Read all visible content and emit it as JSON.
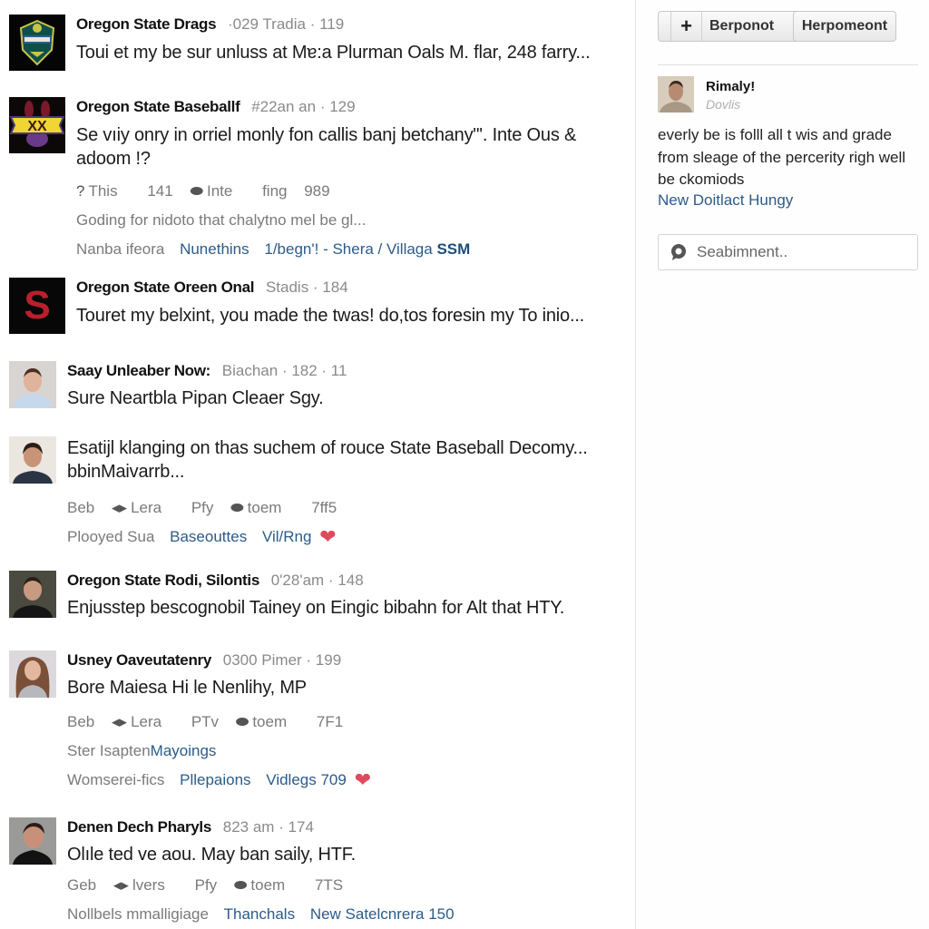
{
  "colors": {
    "link": "#2b5b8a",
    "meta": "#8a8a8a",
    "heart": "#e04a5c",
    "divider": "#e2e2e2"
  },
  "feed": {
    "posts": [
      {
        "author": "Oregon State Drags",
        "meta": "·029 Tradia · 119",
        "avatar": "team-logo-drags",
        "text": "Toui et my be sur unluss at Mɐ:a Plurman Oals M. flar, 248 farry..."
      },
      {
        "author": "Oregon State Baseballf",
        "meta": "#22an an · 129",
        "avatar": "team-logo-xx",
        "text": "Se vıiy onry in orriel monly fon callis banj betchany\"'. Inte Ous & adoom !?",
        "actions": [
          {
            "icon": "question-icon",
            "label": "This"
          },
          {
            "label": "141"
          },
          {
            "icon": "comment-bubble-icon",
            "label": "Inte"
          },
          {
            "label": "fing"
          },
          {
            "label": "989"
          }
        ],
        "line1": "Goding for nidoto that chalytno mel be gl...",
        "line2": {
          "text": "Nanba ifeora",
          "links": [
            "Nunethins",
            "1/begn'! - Shera / Villaga"
          ],
          "strong": "SSM"
        }
      },
      {
        "author": "Oregon State Oreen Onal",
        "meta": "Stadis · 184",
        "avatar": "team-logo-s",
        "avatar_letter": "S",
        "text": "Touret my belxint, you made the twas! do,tos foresin my To inio..."
      },
      {
        "author": "Saay Unleaber Now:",
        "meta": "Biachan · 182 · 11",
        "avatar": "user-photo-man-1",
        "text": "Sure Neartbla Pipan Cleaer Sgy."
      },
      {
        "author": "",
        "meta": "",
        "avatar": "user-photo-man-2",
        "text": "Esatijl klanging on thas suchem of rouce State Baseball Decomy... bbinMaivarrb...",
        "actions": [
          {
            "label": "Beb"
          },
          {
            "icon": "retweet-arrows-icon",
            "label": "Lera"
          },
          {
            "label": "Pfy"
          },
          {
            "icon": "comment-bubble-icon",
            "label": "toem"
          },
          {
            "label": "7ff5"
          }
        ],
        "line2": {
          "text": "Plooyed Sua",
          "links": [
            "Baseouttes",
            "Vil/Rng"
          ],
          "heart": true
        }
      },
      {
        "author": "Oregon State Rodi, Silontis",
        "meta": "0'28'am · 148",
        "avatar": "user-photo-man-3",
        "text": "Enjusstep bescognobil Tainey on Eingic bibahn for Alt that HTY."
      },
      {
        "author": "Usney Oaveutatenry",
        "meta": "0300 Pimer · 199",
        "avatar": "user-photo-woman",
        "text": "Bore Maiesa Hi le Nenlihy, MP",
        "actions": [
          {
            "label": "Beb"
          },
          {
            "icon": "retweet-arrows-icon",
            "label": "Lera"
          },
          {
            "label": "PTv"
          },
          {
            "icon": "comment-bubble-icon",
            "label": "toem"
          },
          {
            "label": "7F1"
          }
        ],
        "line1_prefix": "Ster Isapten",
        "line1_link": "Mayoings",
        "line2": {
          "text": "Womserei-fics",
          "links": [
            "Pllepaions",
            "Vidlegs 709"
          ],
          "heart": true
        }
      },
      {
        "author": "Denen Dech Pharyls",
        "meta": "823 am · 174",
        "avatar": "user-photo-man-4",
        "text": "Olıle ted ve aou. May ban saily, HTF.",
        "actions": [
          {
            "label": "Geb"
          },
          {
            "icon": "retweet-arrows-icon",
            "label": "lvers"
          },
          {
            "label": "Pfy"
          },
          {
            "icon": "comment-bubble-icon",
            "label": "toem"
          },
          {
            "label": "7TS"
          }
        ],
        "line2": {
          "text": "Nollbels mmalligiage",
          "links": [
            "Thanchals",
            "New Satelcnrera 150"
          ]
        }
      }
    ]
  },
  "sidebar": {
    "buttons": [
      {
        "icon": "plus-icon",
        "icon_glyph": "+",
        "label": "Berponot"
      },
      {
        "label": "Herpomeont"
      }
    ],
    "profile": {
      "name": "Rimaly!",
      "subtitle": "Dovlis",
      "text": "everly be is folll all t wis and grade from sleage of the percerity righ well be ckomiods",
      "link": "New Doitlact Hungy"
    },
    "comment_input": {
      "placeholder": "Seabimnent..",
      "value": ""
    }
  }
}
